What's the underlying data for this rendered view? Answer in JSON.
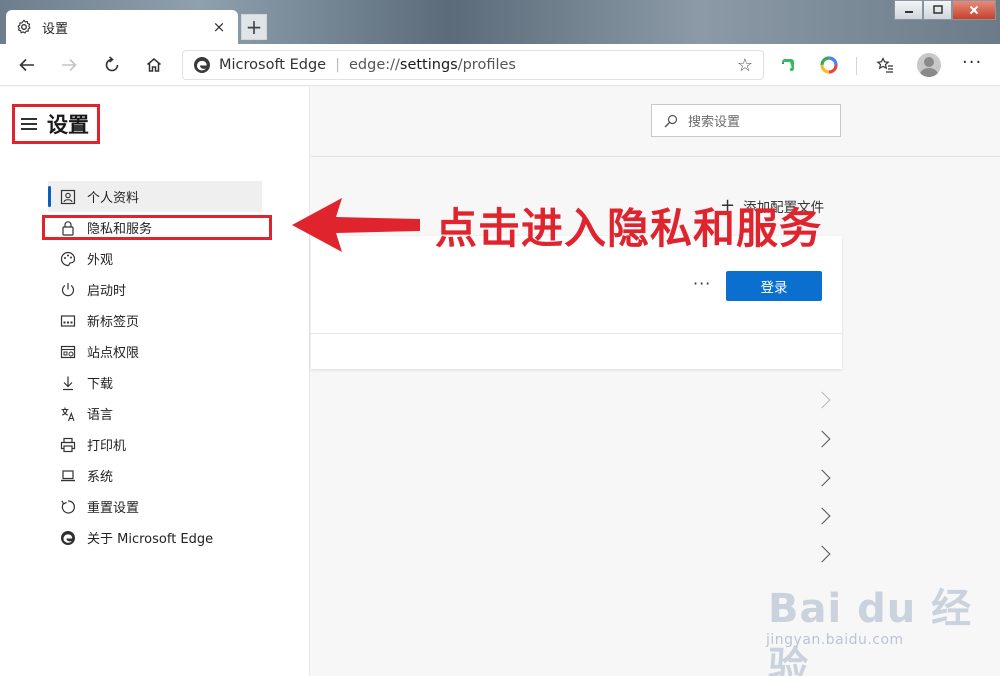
{
  "window": {
    "tab_title": "设置",
    "tab_close": "×",
    "new_tab": "+"
  },
  "address_bar": {
    "site_name": "Microsoft Edge",
    "url_prefix": "edge://",
    "url_host": "settings",
    "url_path": "/profiles"
  },
  "sidebar": {
    "title": "设置",
    "items": [
      {
        "label": "个人资料",
        "icon": "profile-icon",
        "active": true
      },
      {
        "label": "隐私和服务",
        "icon": "lock-icon",
        "active": false
      },
      {
        "label": "外观",
        "icon": "palette-icon",
        "active": false
      },
      {
        "label": "启动时",
        "icon": "power-icon",
        "active": false
      },
      {
        "label": "新标签页",
        "icon": "newtab-icon",
        "active": false
      },
      {
        "label": "站点权限",
        "icon": "site-permissions-icon",
        "active": false
      },
      {
        "label": "下载",
        "icon": "download-icon",
        "active": false
      },
      {
        "label": "语言",
        "icon": "language-icon",
        "active": false
      },
      {
        "label": "打印机",
        "icon": "printer-icon",
        "active": false
      },
      {
        "label": "系统",
        "icon": "laptop-icon",
        "active": false
      },
      {
        "label": "重置设置",
        "icon": "reset-icon",
        "active": false
      },
      {
        "label": "关于 Microsoft Edge",
        "icon": "edge-logo-icon",
        "active": false
      }
    ]
  },
  "main": {
    "search_placeholder": "搜索设置",
    "add_profile_label": "添加配置文件",
    "card_more": "···",
    "login_button": "登录"
  },
  "annotation": {
    "text": "点击进入隐私和服务",
    "color": "#e0242e"
  },
  "watermark": {
    "logo": "Bai du 经验",
    "url": "jingyan.baidu.com"
  },
  "colors": {
    "accent": "#0a6fcf",
    "highlight": "#e0242e",
    "active_indicator": "#0a5fb8"
  }
}
